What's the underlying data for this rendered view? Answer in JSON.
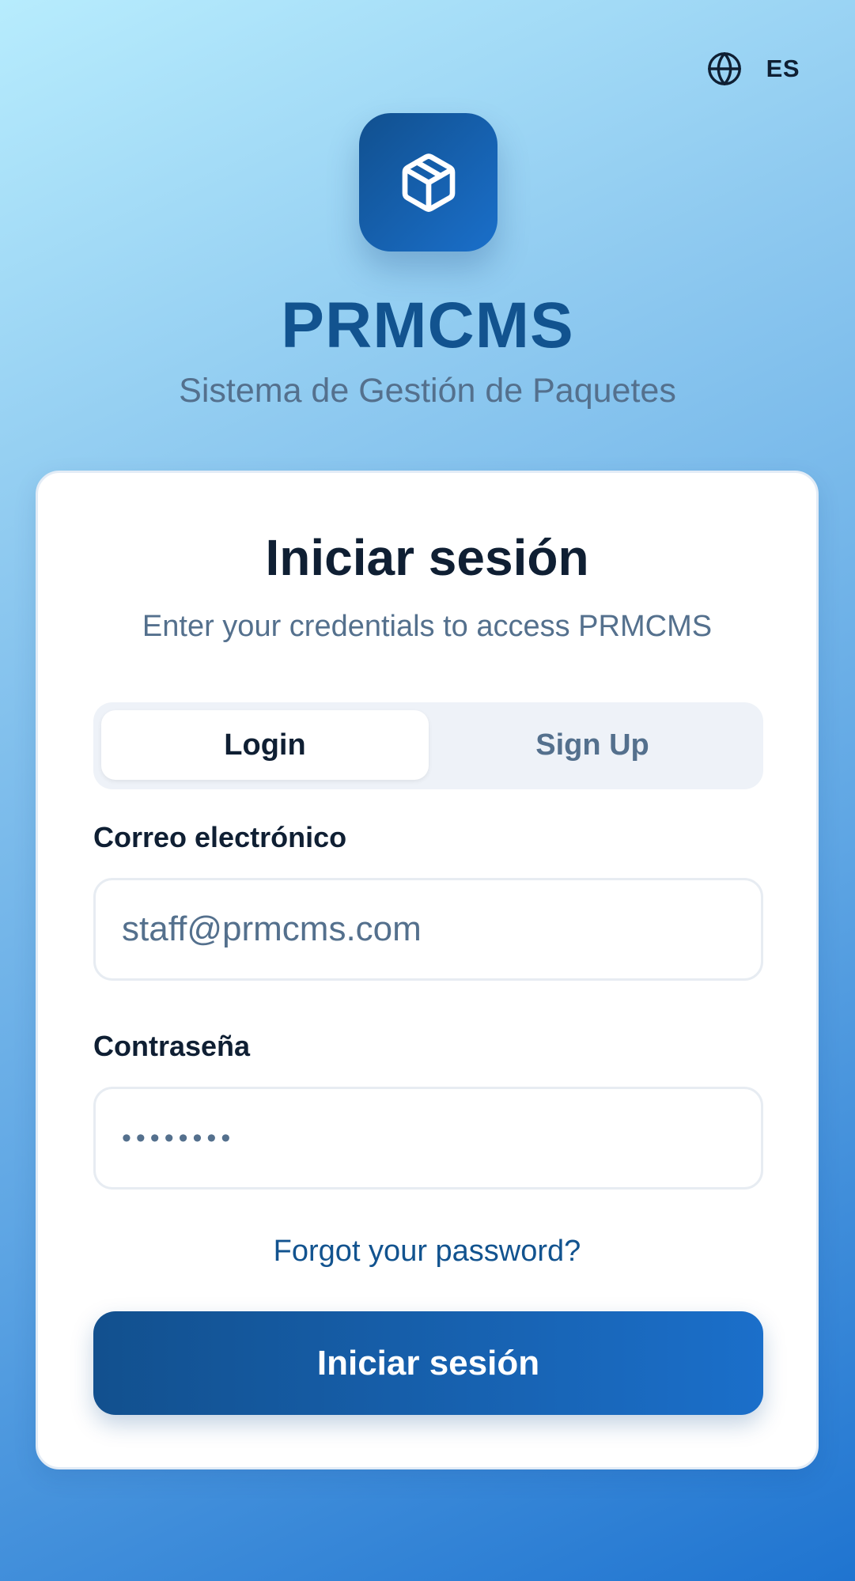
{
  "language": {
    "icon": "globe-icon",
    "label": "ES"
  },
  "logo": {
    "icon": "package-icon"
  },
  "app": {
    "title": "PRMCMS",
    "subtitle": "Sistema de Gestión de Paquetes"
  },
  "card": {
    "title": "Iniciar sesión",
    "subtitle": "Enter your credentials to access PRMCMS",
    "tabs": [
      {
        "label": "Login",
        "active": true
      },
      {
        "label": "Sign Up",
        "active": false
      }
    ],
    "email": {
      "label": "Correo electrónico",
      "value": "staff@prmcms.com"
    },
    "password": {
      "label": "Contraseña",
      "value": "••••••••"
    },
    "forgot_link": "Forgot your password?",
    "submit_label": "Iniciar sesión"
  },
  "colors": {
    "brand": "#12538f",
    "brand_gradient_start": "#11508f",
    "brand_gradient_end": "#1b6fca",
    "text_primary": "#0f1f33",
    "text_muted": "#54708d"
  }
}
